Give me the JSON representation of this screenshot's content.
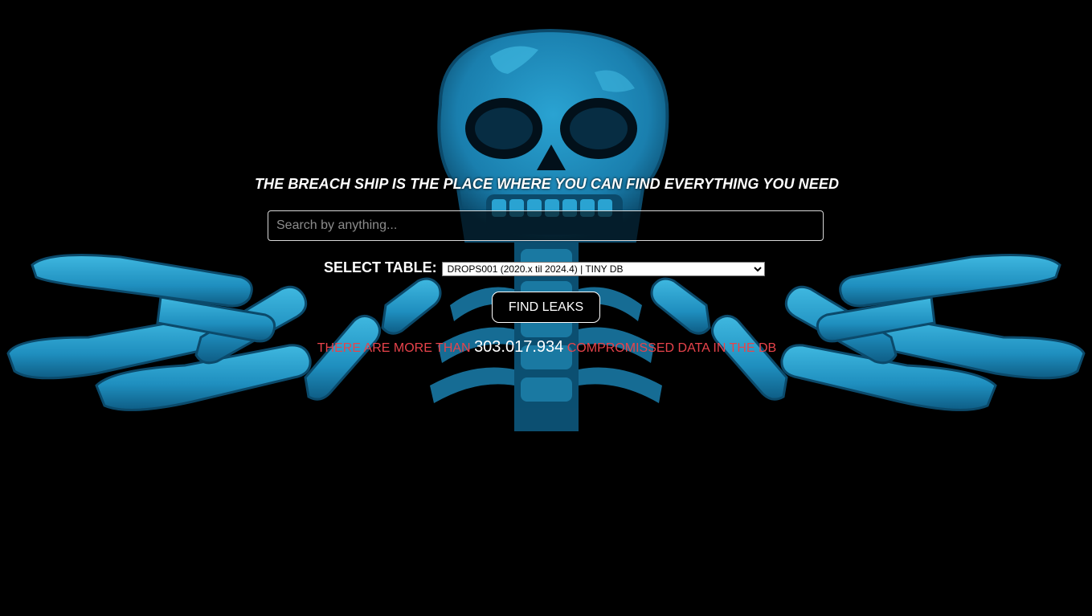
{
  "headline": "THE BREACH SHIP IS THE PLACE WHERE YOU CAN FIND EVERYTHING YOU NEED",
  "search": {
    "placeholder": "Search by anything...",
    "value": ""
  },
  "table_select": {
    "label": "SELECT TABLE:",
    "selected": "DROPS001 (2020.x til 2024.4) | TINY DB"
  },
  "find_button": {
    "label": "FIND LEAKS"
  },
  "stats": {
    "prefix": "THERE ARE MORE THAN ",
    "count": "303.017.934",
    "suffix": " COMPROMISSED DATA IN THE DB"
  },
  "background_art": {
    "icon": "skeleton-icon",
    "colors": {
      "bone": "#1f8fbf",
      "bone_dark": "#0b4a6b",
      "bone_light": "#3fb8e0",
      "background": "#000000"
    }
  },
  "colors": {
    "accent_text": "#e8434b",
    "text": "#ffffff"
  }
}
